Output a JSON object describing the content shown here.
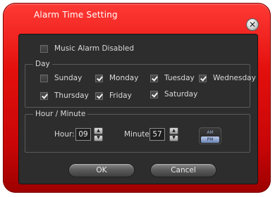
{
  "window": {
    "title": "Alarm Time Setting"
  },
  "music_alarm": {
    "label": "Music Alarm Disabled",
    "checked": false
  },
  "day_group": {
    "label": "Day",
    "days": [
      {
        "label": "Sunday",
        "checked": false
      },
      {
        "label": "Monday",
        "checked": true
      },
      {
        "label": "Tuesday",
        "checked": true
      },
      {
        "label": "Wednesday",
        "checked": true
      },
      {
        "label": "Thursday",
        "checked": true
      },
      {
        "label": "Friday",
        "checked": true
      },
      {
        "label": "Saturday",
        "checked": true
      }
    ]
  },
  "time_group": {
    "label": "Hour / Minute",
    "hour_label": "Hour:",
    "hour_value": "09",
    "minute_label": "Minute:",
    "minute_value": "57",
    "ampm": {
      "options": [
        "AM",
        "PM"
      ],
      "selected": "PM"
    }
  },
  "buttons": {
    "ok": "OK",
    "cancel": "Cancel"
  },
  "colors": {
    "frame": "#e3100d",
    "panel": "#2d2d2d",
    "text": "#d9d9d9"
  },
  "icons": {
    "close": "close-icon",
    "spin_up": "arrow-up-icon",
    "spin_down": "arrow-down-icon"
  }
}
